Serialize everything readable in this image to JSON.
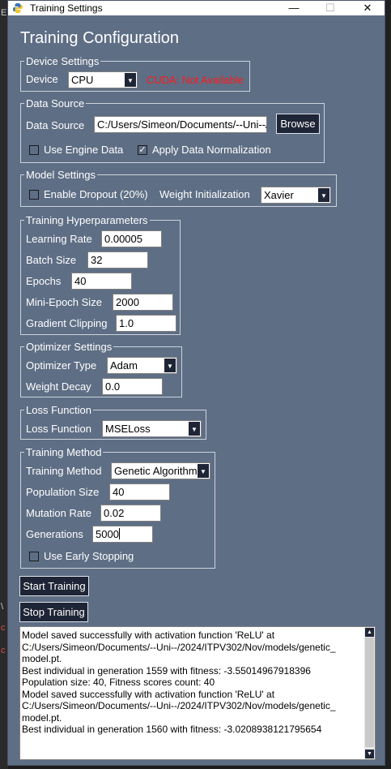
{
  "window": {
    "title": "Training Settings"
  },
  "heading": "Training Configuration",
  "device": {
    "legend": "Device Settings",
    "label": "Device",
    "value": "CPU",
    "cuda_status": "CUDA: Not Available"
  },
  "data_source": {
    "legend": "Data Source",
    "label": "Data Source",
    "path": "C:/Users/Simeon/Documents/--Uni--/",
    "browse": "Browse",
    "use_engine": "Use Engine Data",
    "use_engine_checked": false,
    "normalize": "Apply Data Normalization",
    "normalize_checked": true
  },
  "model": {
    "legend": "Model Settings",
    "dropout": "Enable Dropout (20%)",
    "dropout_checked": false,
    "weight_init_label": "Weight Initialization",
    "weight_init_value": "Xavier"
  },
  "hyper": {
    "legend": "Training Hyperparameters",
    "lr_label": "Learning Rate",
    "lr_value": "0.00005",
    "batch_label": "Batch Size",
    "batch_value": "32",
    "epochs_label": "Epochs",
    "epochs_value": "40",
    "mini_label": "Mini-Epoch Size",
    "mini_value": "2000",
    "clip_label": "Gradient Clipping",
    "clip_value": "1.0"
  },
  "optimizer": {
    "legend": "Optimizer Settings",
    "type_label": "Optimizer Type",
    "type_value": "Adam",
    "decay_label": "Weight Decay",
    "decay_value": "0.0"
  },
  "loss": {
    "legend": "Loss Function",
    "label": "Loss Function",
    "value": "MSELoss"
  },
  "method": {
    "legend": "Training Method",
    "label": "Training Method",
    "value": "Genetic Algorithm",
    "pop_label": "Population Size",
    "pop_value": "40",
    "mut_label": "Mutation Rate",
    "mut_value": "0.02",
    "gen_label": "Generations",
    "gen_value": "5000",
    "early": "Use Early Stopping",
    "early_checked": false
  },
  "buttons": {
    "start": "Start Training",
    "stop": "Stop Training"
  },
  "log": [
    "Model saved successfully with activation function 'ReLU' at",
    "C:/Users/Simeon/Documents/--Uni--/2024/ITPV302/Nov/models/genetic_",
    "model.pt.",
    "Best individual in generation 1559 with fitness: -3.55014967918396",
    "Population size: 40, Fitness scores count: 40",
    "Model saved successfully with activation function 'ReLU' at",
    "C:/Users/Simeon/Documents/--Uni--/2024/ITPV302/Nov/models/genetic_",
    "model.pt.",
    "Best individual in generation 1560 with fitness: -3.0208938121795654"
  ],
  "background_marks": [
    "E",
    "\\",
    "c",
    "c"
  ]
}
